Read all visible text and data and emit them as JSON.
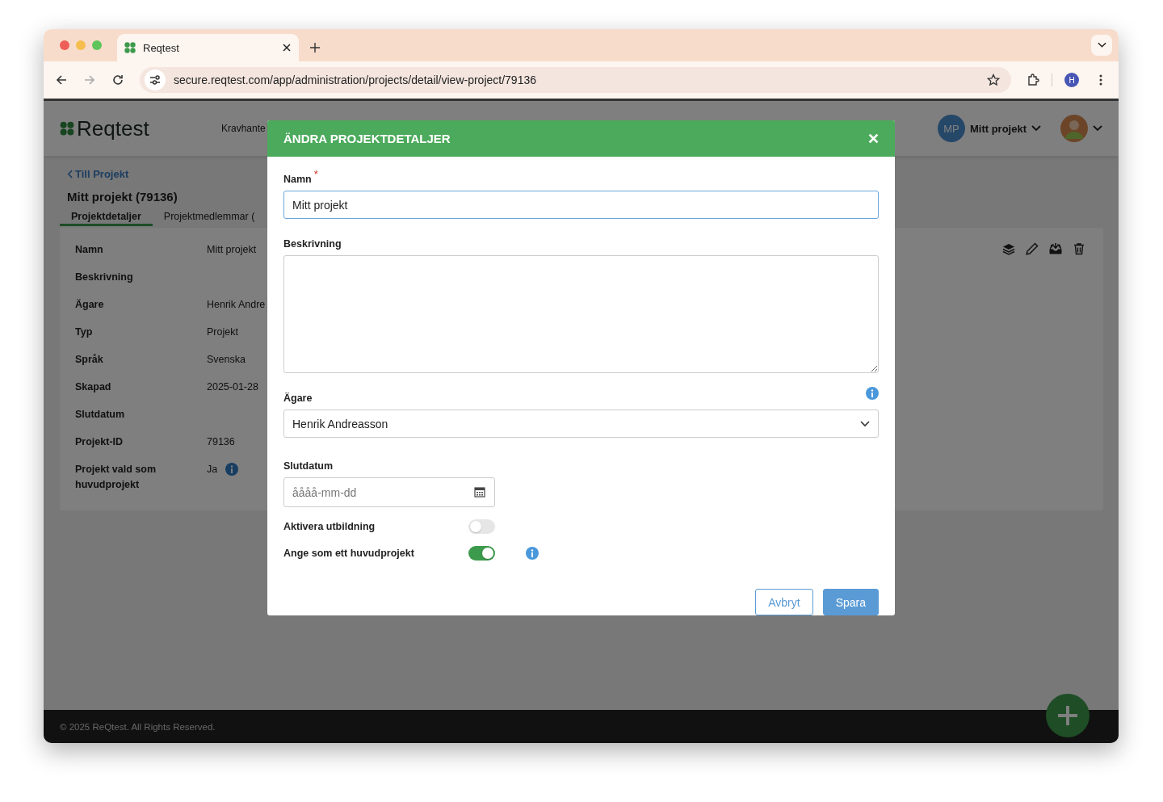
{
  "browser": {
    "tab_title": "Reqtest",
    "url": "secure.reqtest.com/app/administration/projects/detail/view-project/79136",
    "profile_initial": "H"
  },
  "header": {
    "logo": "Reqtest",
    "nav_item": "Kravhante",
    "project_badge": "MP",
    "project_name": "Mitt projekt"
  },
  "page": {
    "back_link": "Till Projekt",
    "title": "Mitt projekt (79136)",
    "tabs": [
      {
        "label": "Projektdetaljer",
        "selected": true
      },
      {
        "label": "Projektmedlemmar (",
        "selected": false
      }
    ],
    "details": [
      {
        "label": "Namn",
        "value": "Mitt projekt"
      },
      {
        "label": "Beskrivning"
      },
      {
        "label": "Ägare",
        "value": "Henrik Andre"
      },
      {
        "label": "Typ",
        "value": "Projekt"
      },
      {
        "label": "Språk",
        "value": "Svenska"
      },
      {
        "label": "Skapad",
        "value": "2025-01-28"
      },
      {
        "label": "Slutdatum"
      },
      {
        "label": "Projekt-ID",
        "value": "79136"
      },
      {
        "label": "Projekt vald som huvudprojekt",
        "value": "Ja",
        "info": true
      }
    ]
  },
  "modal": {
    "title": "ÄNDRA PROJEKTDETALJER",
    "name": {
      "label": "Namn",
      "required_mark": "*",
      "value": "Mitt projekt"
    },
    "description": {
      "label": "Beskrivning"
    },
    "owner": {
      "label": "Ägare",
      "value": "Henrik Andreasson"
    },
    "end_date": {
      "label": "Slutdatum",
      "placeholder": "åååå-mm-dd"
    },
    "toggles": [
      {
        "label": "Aktivera utbildning",
        "on": false
      },
      {
        "label": "Ange som ett huvudprojekt",
        "on": true,
        "info": true
      }
    ],
    "buttons": {
      "cancel": "Avbryt",
      "save": "Spara"
    }
  },
  "footer": {
    "copyright": "© 2025 ReQtest. All Rights Reserved."
  }
}
